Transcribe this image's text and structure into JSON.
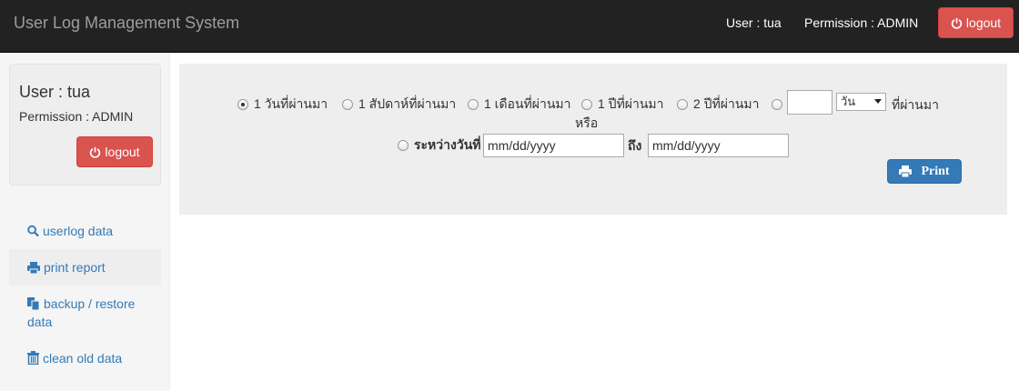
{
  "navbar": {
    "brand": "User Log Management System",
    "user": "User : tua",
    "permission": "Permission : ADMIN",
    "logout": "logout"
  },
  "sidebar": {
    "user": "User : tua",
    "permission": "Permission : ADMIN",
    "logout": "logout",
    "items": [
      {
        "label": "userlog data",
        "icon": "search-icon"
      },
      {
        "label": "print report",
        "icon": "print-icon",
        "active": true
      },
      {
        "label": "backup / restore data",
        "icon": "copy-icon"
      },
      {
        "label": "clean old data",
        "icon": "trash-icon"
      }
    ]
  },
  "filter": {
    "options": [
      {
        "label": "1 วันที่ผ่านมา",
        "checked": true
      },
      {
        "label": "1 สัปดาห์ที่ผ่านมา",
        "checked": false
      },
      {
        "label": "1 เดือนที่ผ่านมา",
        "checked": false
      },
      {
        "label": "1 ปีที่ผ่านมา",
        "checked": false
      },
      {
        "label": "2 ปีที่ผ่านมา",
        "checked": false
      }
    ],
    "custom_count_value": "",
    "unit_selected": "วัน",
    "past_label": "ที่ผ่านมา",
    "or_label": "หรือ",
    "between_label": "ระหว่างวันที่",
    "start_date_placeholder": "mm/dd/yyyy",
    "to_label": "ถึง",
    "end_date_placeholder": "mm/dd/yyyy",
    "print_button": "Print"
  },
  "colors": {
    "navbar_bg": "#222222",
    "danger": "#d9534f",
    "primary": "#337ab7",
    "link": "#337ab7"
  }
}
